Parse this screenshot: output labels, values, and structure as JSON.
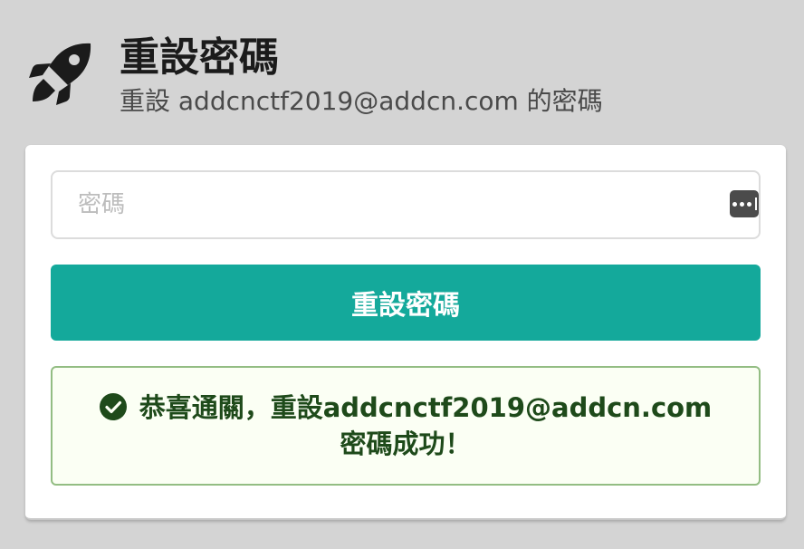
{
  "header": {
    "logo_icon": "rocket-icon",
    "title": "重設密碼",
    "subtitle": "重設 addcnctf2019@addcn.com 的密碼"
  },
  "form": {
    "password_placeholder": "密碼",
    "password_value": "",
    "password_manager_icon": "password-manager-icon",
    "submit_label": "重設密碼"
  },
  "alert": {
    "icon": "check-circle-icon",
    "message": "恭喜通關，重設addcnctf2019@addcn.com密碼成功！"
  },
  "colors": {
    "page_background": "#d4d4d4",
    "accent": "#14a99b",
    "success_text": "#1e4a1a",
    "success_border": "#93bd83",
    "success_background": "#fbfff4"
  }
}
